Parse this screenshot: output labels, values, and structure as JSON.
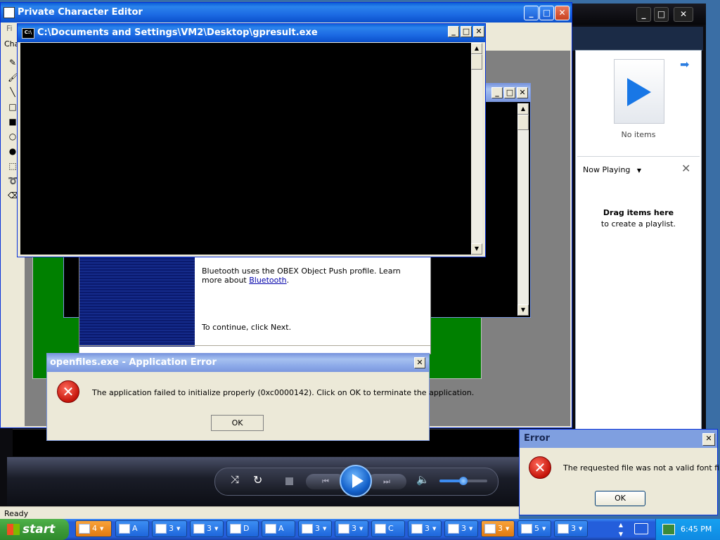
{
  "colors": {
    "xp_blue": "#245edb",
    "desktop": "#3a6ea5",
    "error_red": "#c4140a",
    "console_bg": "#000000",
    "paint_green": "#008000",
    "wizard_navy": "#0a1a6e"
  },
  "pce": {
    "title": "Private Character Editor",
    "menu_file": "Fi",
    "char_label": "Cha",
    "status": "Ready",
    "tools": [
      "pencil-icon",
      "brush-icon",
      "line-icon",
      "rect-outline-icon",
      "rect-fill-icon",
      "ellipse-outline-icon",
      "ellipse-fill-icon",
      "rect-select-icon",
      "lasso-icon",
      "eraser-icon"
    ]
  },
  "cmd": {
    "title": "C:\\Documents and Settings\\VM2\\Desktop\\gpresult.exe"
  },
  "wizard": {
    "text1": "Bluetooth uses the OBEX Object Push profile. Learn more about ",
    "link": "Bluetooth",
    "text1_end": ".",
    "text2": "To continue, click Next."
  },
  "app_error": {
    "title": "openfiles.exe - Application Error",
    "message": "The application failed to initialize properly (0xc0000142). Click on OK to terminate the application.",
    "ok": "OK"
  },
  "wmp": {
    "no_items": "No items",
    "now_playing": "Now Playing",
    "drag_title": "Drag items here",
    "drag_sub": "to create a playlist.",
    "volume_level": 0.5
  },
  "font_error": {
    "title": "Error",
    "message": "The requested file  was not a valid font file.",
    "ok": "OK"
  },
  "taskbar": {
    "start": "start",
    "clock": "6:45 PM",
    "buttons": [
      {
        "icon": "folder-icon",
        "num": "4",
        "dd": true
      },
      {
        "icon": "network-icon",
        "num": "A",
        "dd": false
      },
      {
        "icon": "window-icon",
        "num": "3",
        "dd": true
      },
      {
        "icon": "window-icon",
        "num": "3",
        "dd": true
      },
      {
        "icon": "app-icon",
        "num": "D",
        "dd": false
      },
      {
        "icon": "tool-icon",
        "num": "A",
        "dd": false
      },
      {
        "icon": "document-icon",
        "num": "3",
        "dd": true
      },
      {
        "icon": "console-icon",
        "num": "3",
        "dd": true
      },
      {
        "icon": "chart-icon",
        "num": "C",
        "dd": false
      },
      {
        "icon": "window-icon",
        "num": "3",
        "dd": true
      },
      {
        "icon": "window-icon",
        "num": "3",
        "dd": true
      },
      {
        "icon": "settings-icon",
        "num": "3",
        "dd": true
      },
      {
        "icon": "window-icon",
        "num": "5",
        "dd": true
      },
      {
        "icon": "calendar-icon",
        "num": "3",
        "dd": true
      }
    ]
  }
}
